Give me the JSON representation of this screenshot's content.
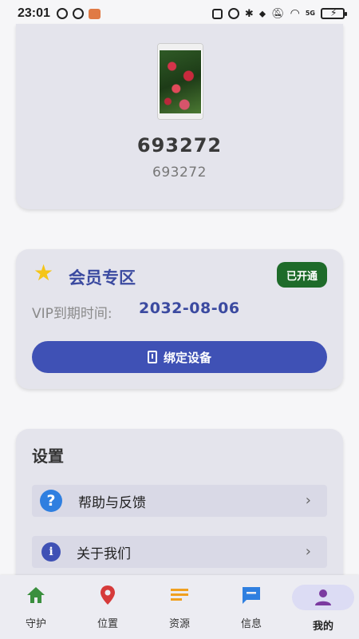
{
  "status_bar": {
    "time": "23:01",
    "left_icons": [
      "eye-icon",
      "wechat-icon",
      "message-badge-icon"
    ],
    "right_icons": [
      "nfc-icon",
      "alarm-icon",
      "bluetooth-icon",
      "location-icon",
      "mute-icon",
      "wifi-icon",
      "signal-5g-icon",
      "battery-charging-icon"
    ],
    "network_label": "5G"
  },
  "profile": {
    "name": "693272",
    "subtitle": "693272"
  },
  "vip": {
    "title": "会员专区",
    "badge": "已开通",
    "expire_label": "VIP到期时间:",
    "expire_date": "2032-08-06",
    "bind_button_label": "绑定设备",
    "colors": {
      "accent": "#3f51b5",
      "badge": "#1e6b2a",
      "star": "#f5c518"
    }
  },
  "settings": {
    "title": "设置",
    "items": [
      {
        "label": "帮助与反馈",
        "icon": "help-icon"
      },
      {
        "label": "关于我们",
        "icon": "info-icon"
      }
    ]
  },
  "bottom_nav": {
    "items": [
      {
        "label": "守护",
        "icon": "home-icon",
        "color": "#3a8f3e"
      },
      {
        "label": "位置",
        "icon": "location-pin-icon",
        "color": "#d63a3a"
      },
      {
        "label": "资源",
        "icon": "list-icon",
        "color": "#f0a020"
      },
      {
        "label": "信息",
        "icon": "chat-icon",
        "color": "#2f7fe0"
      },
      {
        "label": "我的",
        "icon": "person-icon",
        "color": "#7b3aa0",
        "active": true
      }
    ]
  }
}
